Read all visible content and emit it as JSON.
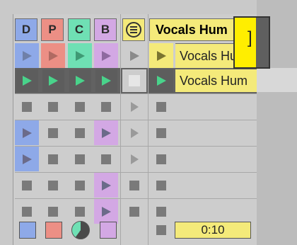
{
  "tracks": [
    {
      "label": "D",
      "color": "#8ea9e8"
    },
    {
      "label": "P",
      "color": "#ec8f85"
    },
    {
      "label": "C",
      "color": "#6fe0b4"
    },
    {
      "label": "B",
      "color": "#d3a8e4"
    }
  ],
  "master_color": "#f4ea7a",
  "clip_track_title": "Vocals Hum",
  "clips": [
    "Vocals Hum",
    "Vocals Hum"
  ],
  "time": "0:10",
  "active_clip_color": "#ffee00"
}
